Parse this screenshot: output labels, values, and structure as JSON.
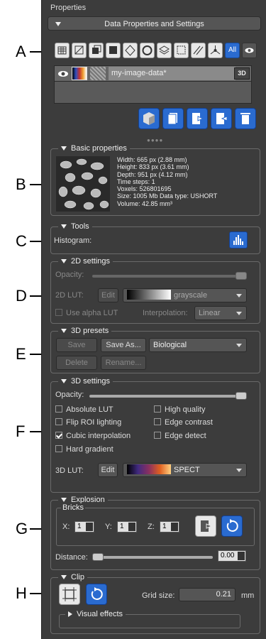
{
  "panel": {
    "title": "Properties",
    "header": "Data Properties and Settings"
  },
  "annotations": [
    "A",
    "B",
    "C",
    "D",
    "E",
    "F",
    "G",
    "H"
  ],
  "toolbar": {
    "all_label": "All",
    "icons": [
      "grid-icon",
      "select-icon",
      "copy-icon",
      "square-icon",
      "polygon-icon",
      "round-icon",
      "layers-icon",
      "crop-icon",
      "stripes-icon",
      "node-icon",
      "all-button",
      "eye-icon"
    ]
  },
  "layer": {
    "name": "my-image-data*",
    "badge": "3D"
  },
  "basic": {
    "title": "Basic properties",
    "lines": [
      "Width: 665 px (2.88 mm)",
      "Height: 833 px (3.61 mm)",
      "Depth: 951 px (4.12 mm)",
      "Time steps: 1",
      "Voxels: 526801695",
      "Size: 1005 Mb  Data type: USHORT",
      "Volume: 42.85 mm³"
    ]
  },
  "tools": {
    "title": "Tools",
    "histogram": "Histogram:"
  },
  "settings2d": {
    "title": "2D settings",
    "opacity": "Opacity:",
    "lut": "2D LUT:",
    "edit": "Edit",
    "lut_value": "grayscale",
    "use_alpha": "Use alpha LUT",
    "interp_label": "Interpolation:",
    "interp_value": "Linear"
  },
  "presets": {
    "title": "3D presets",
    "save": "Save",
    "save_as": "Save As...",
    "preset_value": "Biological",
    "delete": "Delete",
    "rename": "Rename..."
  },
  "settings3d": {
    "title": "3D settings",
    "opacity": "Opacity:",
    "absolute_lut": "Absolute LUT",
    "high_quality": "High quality",
    "flip_roi": "Flip ROI lighting",
    "edge_contrast": "Edge contrast",
    "cubic": "Cubic interpolation",
    "edge_detect": "Edge detect",
    "hard_gradient": "Hard gradient",
    "lut": "3D LUT:",
    "edit": "Edit",
    "lut_value": "SPECT"
  },
  "explosion": {
    "title": "Explosion",
    "bricks": "Bricks",
    "x": "X:",
    "y": "Y:",
    "z": "Z:",
    "x_val": "1",
    "y_val": "1",
    "z_val": "1",
    "distance": "Distance:",
    "distance_val": "0.00"
  },
  "clip": {
    "title": "Clip",
    "grid_label": "Grid size:",
    "grid_value": "0.21",
    "unit": "mm",
    "visual_effects": "Visual effects"
  }
}
